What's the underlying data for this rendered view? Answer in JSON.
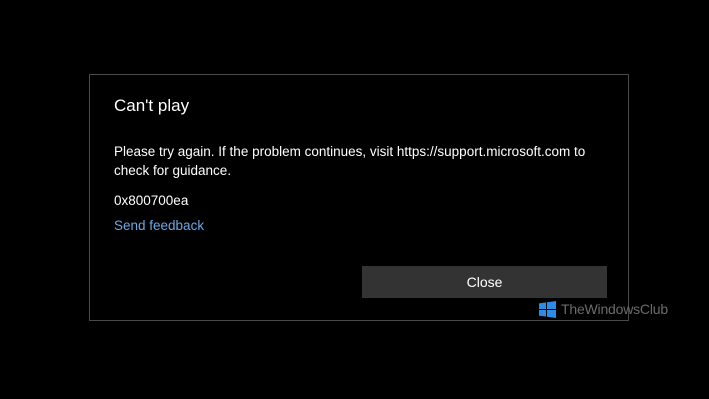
{
  "dialog": {
    "title": "Can't play",
    "message": "Please try again. If the problem continues, visit https://support.microsoft.com to check for guidance.",
    "error_code": "0x800700ea",
    "feedback_link": "Send feedback",
    "close_label": "Close"
  },
  "watermark": {
    "text": "TheWindowsClub",
    "icon": "windows-logo-icon"
  },
  "colors": {
    "background": "#000000",
    "dialog_border": "#4a4a4a",
    "text": "#ffffff",
    "link": "#6aa9e6",
    "button_bg": "#333333",
    "watermark_logo": "#2b8de8",
    "watermark_text": "#6b6b6b"
  }
}
